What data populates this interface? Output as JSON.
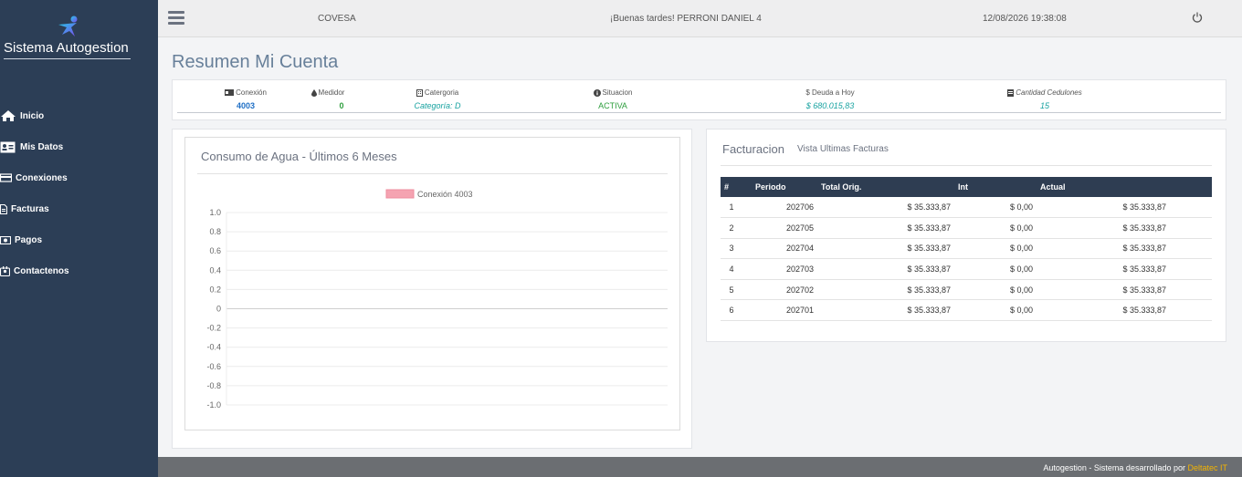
{
  "sidebar": {
    "brand": "Sistema Autogestion",
    "items": [
      {
        "label": "Inicio",
        "icon": "home-icon"
      },
      {
        "label": "Mis Datos",
        "icon": "id-card-icon"
      },
      {
        "label": "Conexiones",
        "icon": "credit-card-icon"
      },
      {
        "label": "Facturas",
        "icon": "file-icon"
      },
      {
        "label": "Pagos",
        "icon": "money-icon"
      },
      {
        "label": "Contactenos",
        "icon": "contact-icon"
      }
    ]
  },
  "topbar": {
    "company": "COVESA",
    "greeting": "¡Buenas tardes! PERRONI DANIEL 4",
    "datetime": "12/08/2026 19:38:08"
  },
  "page_title": "Resumen Mi Cuenta",
  "summary": [
    {
      "label": "Conexión",
      "value": "4003",
      "icon": "id-card-icon",
      "color": "#1f6fc5"
    },
    {
      "label": "Medidor",
      "value": "0",
      "icon": "drop-icon",
      "color": "#2e9e3e"
    },
    {
      "label": "Catergoria",
      "value": "Categoría: D",
      "icon": "building-icon",
      "color": "#17a2a0"
    },
    {
      "label": "Situacion",
      "value": "ACTIVA",
      "icon": "info-icon",
      "color": "#2e9e3e"
    },
    {
      "label": "$ Deuda a Hoy",
      "value": "$ 680.015,83",
      "icon": "",
      "color": "#17a2a0"
    },
    {
      "label": "Cantidad Cedulones",
      "value": "15",
      "icon": "list-icon",
      "color": "#17a2a0"
    }
  ],
  "chart_panel": {
    "title": "Consumo de Agua - Últimos 6 Meses"
  },
  "chart_data": {
    "type": "bar",
    "series": [
      {
        "name": "Conexión 4003",
        "values": [],
        "color": "#f5a3b1"
      }
    ],
    "categories": [],
    "ylim": [
      -1.0,
      1.0
    ],
    "yticks": [
      "1.0",
      "0.8",
      "0.6",
      "0.4",
      "0.2",
      "0",
      "-0.2",
      "-0.4",
      "-0.6",
      "-0.8",
      "-1.0"
    ],
    "legend": "top"
  },
  "facturacion": {
    "title": "Facturacion",
    "subtitle": "Vista Ultimas Facturas",
    "columns": [
      "#",
      "Periodo",
      "Total Orig.",
      "Int",
      "Actual"
    ],
    "rows": [
      [
        "1",
        "202706",
        "$ 35.333,87",
        "$ 0,00",
        "$ 35.333,87"
      ],
      [
        "2",
        "202705",
        "$ 35.333,87",
        "$ 0,00",
        "$ 35.333,87"
      ],
      [
        "3",
        "202704",
        "$ 35.333,87",
        "$ 0,00",
        "$ 35.333,87"
      ],
      [
        "4",
        "202703",
        "$ 35.333,87",
        "$ 0,00",
        "$ 35.333,87"
      ],
      [
        "5",
        "202702",
        "$ 35.333,87",
        "$ 0,00",
        "$ 35.333,87"
      ],
      [
        "6",
        "202701",
        "$ 35.333,87",
        "$ 0,00",
        "$ 35.333,87"
      ]
    ]
  },
  "footer": {
    "text": "Autogestion - Sistema desarrollado por ",
    "link": "Deltatec IT"
  }
}
